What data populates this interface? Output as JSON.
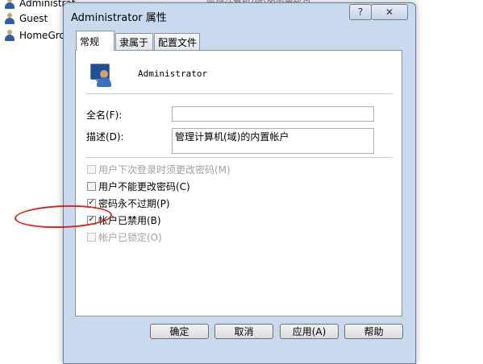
{
  "background_list": {
    "items": [
      {
        "label": "Administrat"
      },
      {
        "label": "Guest"
      },
      {
        "label": "HomeGro"
      }
    ],
    "header_fragment": "管理计算机(域)的内置帐户"
  },
  "dialog": {
    "title": "Administrator 属性",
    "help_symbol": "?",
    "close_symbol": "✕",
    "tabs": [
      {
        "label": "常规"
      },
      {
        "label": "隶属于"
      },
      {
        "label": "配置文件"
      }
    ],
    "username": "Administrator",
    "fields": {
      "full_name_label": "全名(F):",
      "full_name_value": "",
      "description_label": "描述(D):",
      "description_value": "管理计算机(域)的内置帐户"
    },
    "checkboxes": [
      {
        "label": "用户下次登录时须更改密码(M)",
        "checked": false,
        "enabled": false
      },
      {
        "label": "用户不能更改密码(C)",
        "checked": false,
        "enabled": true
      },
      {
        "label": "密码永不过期(P)",
        "checked": true,
        "enabled": true
      },
      {
        "label": "帐户已禁用(B)",
        "checked": true,
        "enabled": true
      },
      {
        "label": "帐户已锁定(O)",
        "checked": false,
        "enabled": false
      }
    ],
    "buttons": {
      "ok": "确定",
      "cancel": "取消",
      "apply": "应用(A)",
      "help": "帮助"
    }
  },
  "colors": {
    "window_frame": "#c9daef",
    "annotation": "#d6251c"
  }
}
